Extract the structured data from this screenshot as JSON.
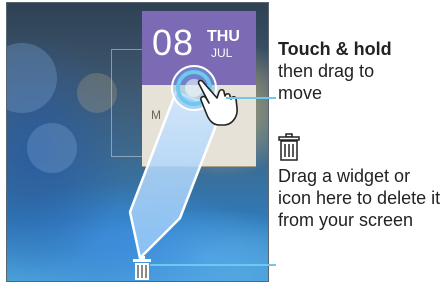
{
  "clock": {
    "date": "08",
    "day": "THU",
    "month": "JUL"
  },
  "card": {
    "stub_text": "M"
  },
  "callouts": {
    "touch_hold": {
      "title": "Touch & hold",
      "body": "then drag to move"
    },
    "drag_delete": {
      "body": "Drag a widget or icon here to delete it from your screen"
    }
  },
  "icons": {
    "touch_target": "touch-ring-icon",
    "hand": "hand-pointer-icon",
    "remove_target": "trash-can-icon",
    "legend_trash": "trash-can-icon"
  },
  "colors": {
    "accent_blue": "#6fc8ee",
    "clock_purple": "#7d6ab5",
    "card_beige": "#e7e2d8"
  }
}
